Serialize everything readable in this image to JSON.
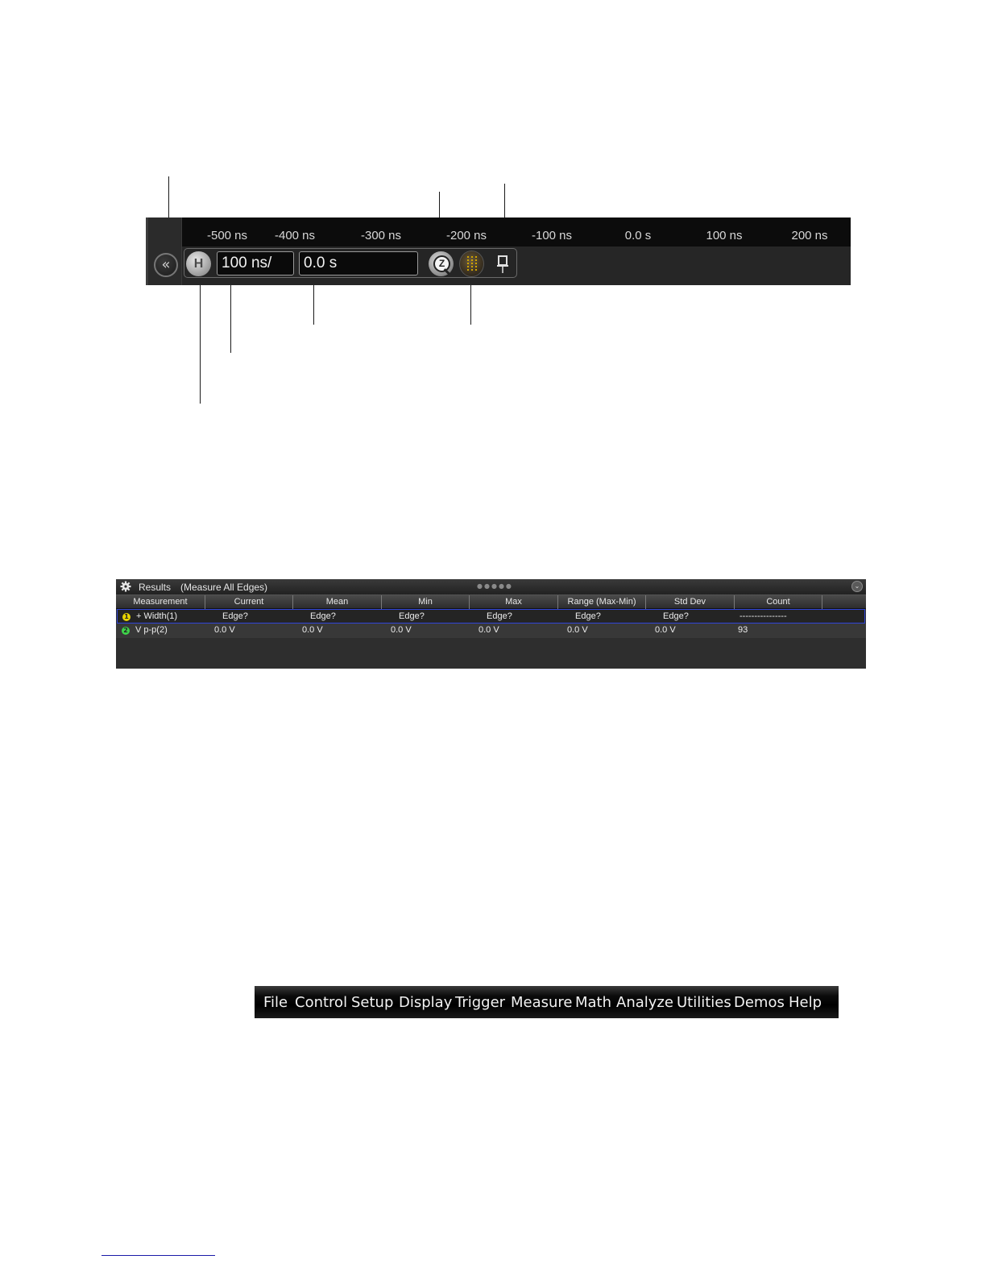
{
  "horizontal_bar": {
    "ruler_ticks": [
      "-500 ns",
      "-400 ns",
      "-300 ns",
      "-200 ns",
      "-100 ns",
      "0.0 s",
      "100 ns",
      "200 ns"
    ],
    "collapse_glyph": "«",
    "horizontal_button_label": "H",
    "scale_value": "100 ns/",
    "position_value": "0.0 s",
    "zoom_glyph": "Z",
    "icons": [
      "collapse-chevrons-icon",
      "horizontal-h-icon",
      "zoom-magnifier-icon",
      "horizontal-knob-icon",
      "pin-icon"
    ],
    "knob_color": "#d1a500"
  },
  "results": {
    "title": "Results",
    "subtitle": "(Measure All Edges)",
    "columns": [
      "Measurement",
      "Current",
      "Mean",
      "Min",
      "Max",
      "Range (Max-Min)",
      "Std Dev",
      "Count"
    ],
    "rows": [
      {
        "source": "1",
        "source_color": "#e8d400",
        "name": "+ Width(1)",
        "current": "Edge?",
        "mean": "Edge?",
        "min": "Edge?",
        "max": "Edge?",
        "range": "Edge?",
        "std_dev": "Edge?",
        "count": "----------------"
      },
      {
        "source": "2",
        "source_color": "#3ed44a",
        "name": "V p-p(2)",
        "current": "0.0 V",
        "mean": "0.0 V",
        "min": "0.0 V",
        "max": "0.0 V",
        "range": "0.0 V",
        "std_dev": "0.0 V",
        "count": "93"
      }
    ],
    "selected_row_border": "#3045d8"
  },
  "menu": {
    "items": [
      "File",
      "Control",
      "Setup",
      "Display",
      "Trigger",
      "Measure",
      "Math",
      "Analyze",
      "Utilities",
      "Demos",
      "Help"
    ]
  }
}
